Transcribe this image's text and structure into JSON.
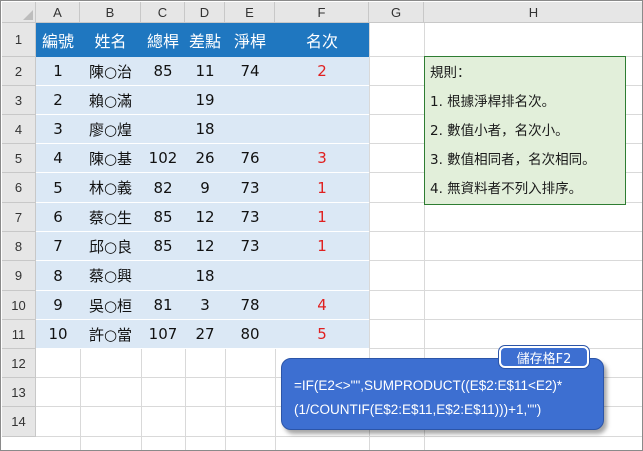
{
  "columns": [
    "A",
    "B",
    "C",
    "D",
    "E",
    "F",
    "G",
    "H"
  ],
  "rows": [
    "1",
    "2",
    "3",
    "4",
    "5",
    "6",
    "7",
    "8",
    "9",
    "10",
    "11",
    "12",
    "13",
    "14"
  ],
  "table": {
    "headers": [
      "編號",
      "姓名",
      "總桿",
      "差點",
      "淨桿",
      "名次"
    ],
    "rows": [
      [
        "1",
        "陳○治",
        "85",
        "11",
        "74",
        "2"
      ],
      [
        "2",
        "賴○滿",
        "",
        "19",
        "",
        ""
      ],
      [
        "3",
        "廖○煌",
        "",
        "18",
        "",
        ""
      ],
      [
        "4",
        "陳○基",
        "102",
        "26",
        "76",
        "3"
      ],
      [
        "5",
        "林○義",
        "82",
        "9",
        "73",
        "1"
      ],
      [
        "6",
        "蔡○生",
        "85",
        "12",
        "73",
        "1"
      ],
      [
        "7",
        "邱○良",
        "85",
        "12",
        "73",
        "1"
      ],
      [
        "8",
        "蔡○興",
        "",
        "18",
        "",
        ""
      ],
      [
        "9",
        "吳○桓",
        "81",
        "3",
        "78",
        "4"
      ],
      [
        "10",
        "許○當",
        "107",
        "27",
        "80",
        "5"
      ]
    ]
  },
  "rules": {
    "title": "規則：",
    "items": [
      "1. 根據淨桿排名次。",
      "2. 數值小者，名次小。",
      "3. 數值相同者，名次相同。",
      "4. 無資料者不列入排序。"
    ]
  },
  "formula": {
    "tag": "儲存格F2",
    "line1": "=IF(E2<>\"\",SUMPRODUCT((E$2:E$11<E2)*",
    "line2": "(1/COUNTIF(E$2:E$11,E$2:E$11)))+1,\"\")"
  },
  "colors": {
    "header_bg": "#1f77c0",
    "row_bg": "#dbe8f5",
    "rank_text": "#e02020",
    "rules_bg": "#e2efda",
    "formula_bg": "#3d6fd1"
  }
}
